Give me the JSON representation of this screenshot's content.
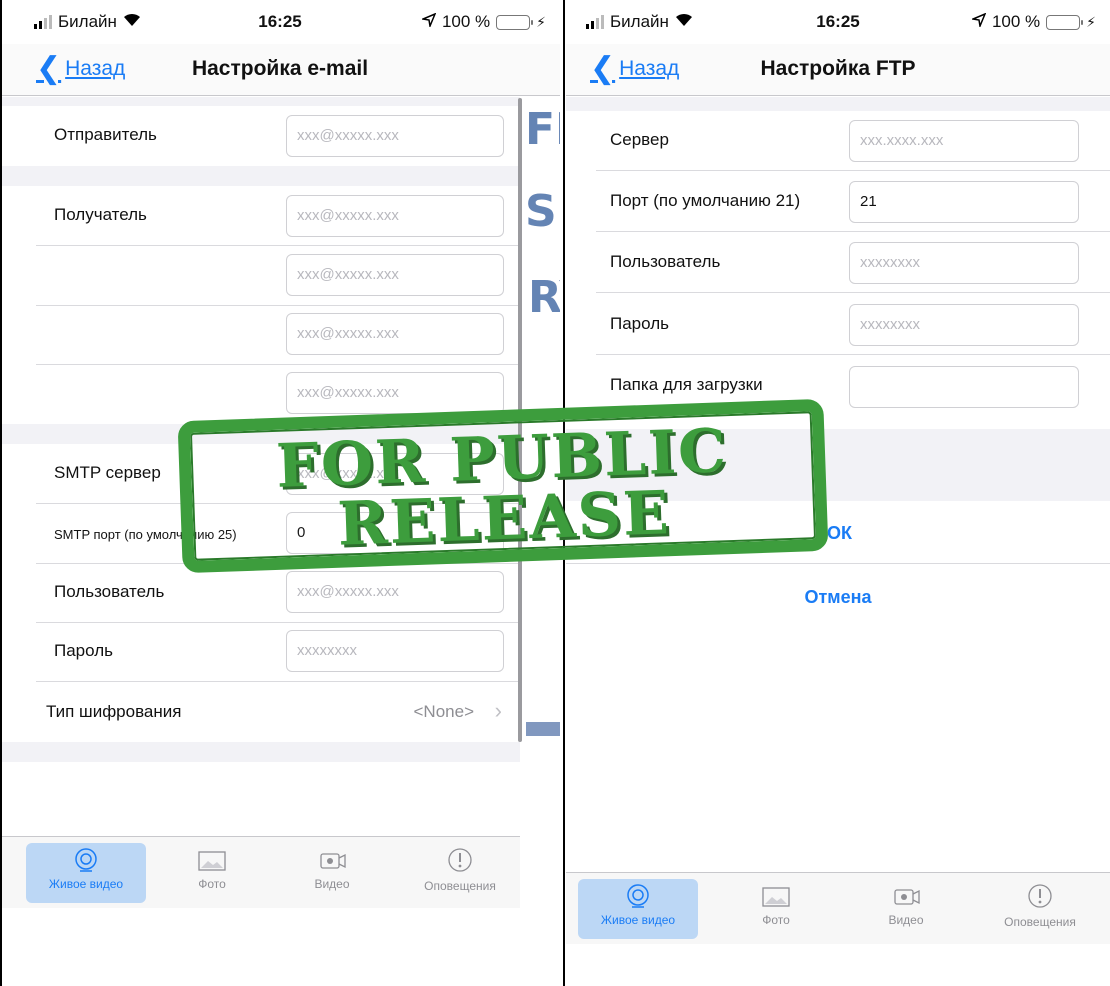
{
  "status": {
    "carrier": "Билайн",
    "time": "16:25",
    "battery_pct": "100 %",
    "battery_level": 1.0
  },
  "nav": {
    "back_label": "Назад"
  },
  "email": {
    "title": "Настройка e-mail",
    "sender_label": "Отправитель",
    "sender_placeholder": "xxx@xxxxx.xxx",
    "recipient_label": "Получатель",
    "recipient_placeholders": [
      "xxx@xxxxx.xxx",
      "xxx@xxxxx.xxx",
      "xxx@xxxxx.xxx",
      "xxx@xxxxx.xxx"
    ],
    "smtp_server_label": "SMTP сервер",
    "smtp_server_placeholder": "xxx@xxxxx.xxx",
    "smtp_port_label": "SMTP порт (по умолчанию 25)",
    "smtp_port_value": "0",
    "user_label": "Пользователь",
    "user_placeholder": "xxx@xxxxx.xxx",
    "password_label": "Пароль",
    "password_placeholder": "xxxxxxxx",
    "encryption_label": "Тип шифрования",
    "encryption_value": "<None>"
  },
  "ftp": {
    "title": "Настройка FTP",
    "server_label": "Сервер",
    "server_placeholder": "xxx.xxxx.xxx",
    "port_label": "Порт (по умолчанию 21)",
    "port_value": "21",
    "user_label": "Пользователь",
    "user_placeholder": "xxxxxxxx",
    "password_label": "Пароль",
    "password_placeholder": "xxxxxxxx",
    "folder_label": "Папка для загрузки",
    "folder_value": "",
    "ok_label": "ОК",
    "cancel_label": "Отмена"
  },
  "tabs": [
    "Живое видео",
    "Фото",
    "Видео",
    "Оповещения"
  ],
  "stamp": {
    "line1": "FOR PUBLIC",
    "line2": "RELEASE"
  },
  "watermark": {
    "w1": "FI",
    "w2": "SE",
    "w3": "RY"
  },
  "colors": {
    "accent": "#1a7cf5",
    "stamp": "#3d9d3d",
    "battery": "#3ec14a"
  }
}
